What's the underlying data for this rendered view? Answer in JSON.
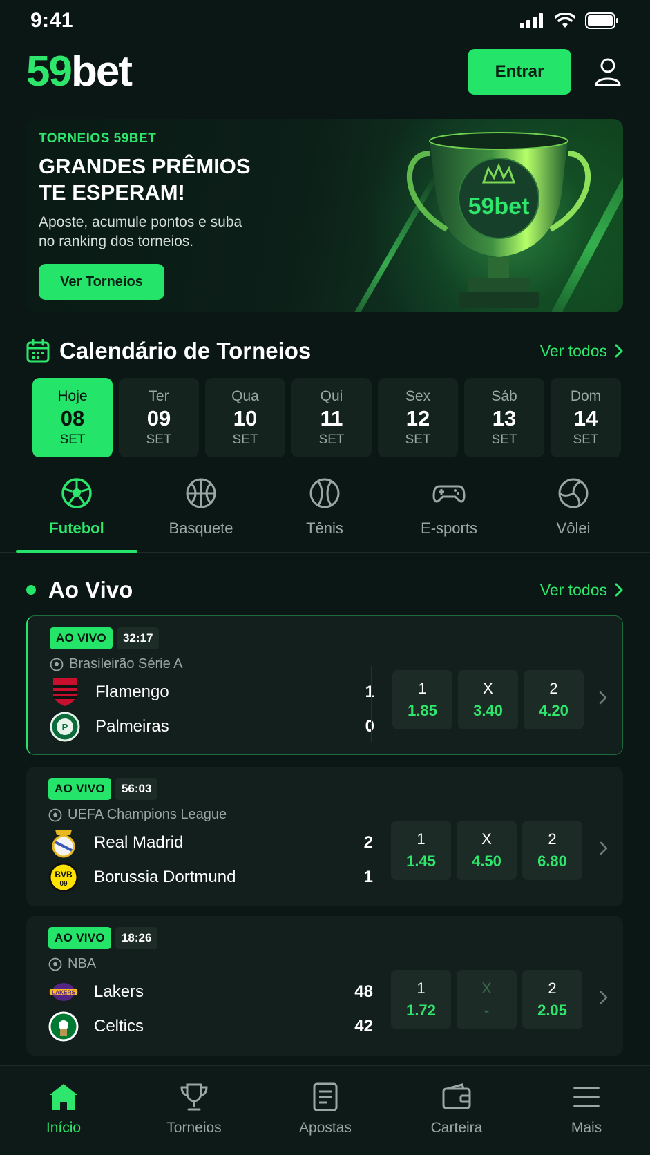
{
  "status_bar": {
    "time": "9:41"
  },
  "header": {
    "logo_number": "59",
    "logo_word": "bet",
    "login_label": "Entrar"
  },
  "banner": {
    "eyebrow": "TORNEIOS 59BET",
    "title_line1": "GRANDES PRÊMIOS",
    "title_line2": "TE ESPERAM!",
    "subtitle_line1": "Aposte, acumule pontos e suba",
    "subtitle_line2": "no ranking dos torneios.",
    "cta_label": "Ver Torneios",
    "trophy_text": "59bet"
  },
  "calendar": {
    "title": "Calendário de Torneios",
    "see_all": "Ver todos",
    "days": [
      {
        "name": "Hoje",
        "num": "08",
        "month": "SET",
        "active": true
      },
      {
        "name": "Ter",
        "num": "09",
        "month": "SET"
      },
      {
        "name": "Qua",
        "num": "10",
        "month": "SET"
      },
      {
        "name": "Qui",
        "num": "11",
        "month": "SET"
      },
      {
        "name": "Sex",
        "num": "12",
        "month": "SET"
      },
      {
        "name": "Sáb",
        "num": "13",
        "month": "SET"
      },
      {
        "name": "Dom",
        "num": "14",
        "month": "SET"
      }
    ]
  },
  "sports": [
    {
      "label": "Futebol",
      "icon": "soccer-ball-icon",
      "active": true
    },
    {
      "label": "Basquete",
      "icon": "basketball-icon"
    },
    {
      "label": "Tênis",
      "icon": "tennis-ball-icon"
    },
    {
      "label": "E-sports",
      "icon": "gamepad-icon"
    },
    {
      "label": "Vôlei",
      "icon": "volleyball-icon"
    }
  ],
  "live": {
    "title": "Ao Vivo",
    "see_all": "Ver todos",
    "matches": [
      {
        "badge": "AO VIVO",
        "clock": "32:17",
        "league": "Brasileirão Série A",
        "home": {
          "name": "Flamengo",
          "score": "1"
        },
        "away": {
          "name": "Palmeiras",
          "score": "0"
        },
        "odds": [
          {
            "label": "1",
            "value": "1.85"
          },
          {
            "label": "X",
            "value": "3.40"
          },
          {
            "label": "2",
            "value": "4.20"
          }
        ]
      },
      {
        "badge": "AO VIVO",
        "clock": "56:03",
        "league": "UEFA Champions League",
        "home": {
          "name": "Real Madrid",
          "score": "2"
        },
        "away": {
          "name": "Borussia Dortmund",
          "score": "1"
        },
        "odds": [
          {
            "label": "1",
            "value": "1.45"
          },
          {
            "label": "X",
            "value": "4.50"
          },
          {
            "label": "2",
            "value": "6.80"
          }
        ]
      },
      {
        "badge": "AO VIVO",
        "clock": "18:26",
        "league": "NBA",
        "home": {
          "name": "Lakers",
          "score": "48"
        },
        "away": {
          "name": "Celtics",
          "score": "42"
        },
        "odds": [
          {
            "label": "1",
            "value": "1.72"
          },
          {
            "label": "X",
            "value": "-"
          },
          {
            "label": "2",
            "value": "2.05"
          }
        ]
      }
    ]
  },
  "bottom_nav": [
    {
      "label": "Início",
      "active": true
    },
    {
      "label": "Torneios"
    },
    {
      "label": "Apostas"
    },
    {
      "label": "Carteira"
    },
    {
      "label": "Mais"
    }
  ],
  "colors": {
    "accent": "#25e46a",
    "background": "#0b1715",
    "card": "#121f1c"
  }
}
